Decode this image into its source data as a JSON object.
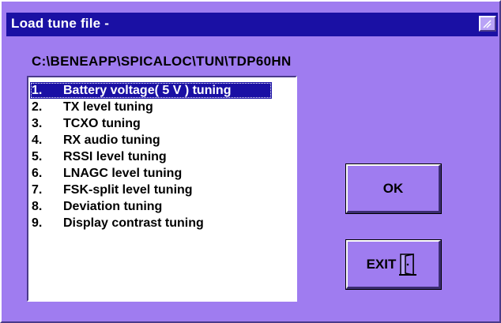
{
  "window": {
    "title": "Load tune file -",
    "title_button_icon": "resize-icon"
  },
  "path": "C:\\BENEAPP\\SPICALOC\\TUN\\TDP60HN",
  "list": {
    "selected_index": 0,
    "items": [
      {
        "num": "1.",
        "label": "Battery voltage( 5 V ) tuning"
      },
      {
        "num": "2.",
        "label": "TX level tuning"
      },
      {
        "num": "3.",
        "label": "TCXO tuning"
      },
      {
        "num": "4.",
        "label": "RX audio tuning"
      },
      {
        "num": "5.",
        "label": "RSSI level tuning"
      },
      {
        "num": "6.",
        "label": "LNAGC level tuning"
      },
      {
        "num": "7.",
        "label": "FSK-split level tuning"
      },
      {
        "num": "8.",
        "label": "Deviation tuning"
      },
      {
        "num": "9.",
        "label": "Display contrast tuning"
      }
    ]
  },
  "buttons": {
    "ok_label": "OK",
    "exit_label": "EXIT",
    "exit_icon": "door-exit-icon"
  },
  "colors": {
    "background": "#9f7cf0",
    "titlebar": "#1a10a4",
    "selection": "#1a10a4"
  }
}
